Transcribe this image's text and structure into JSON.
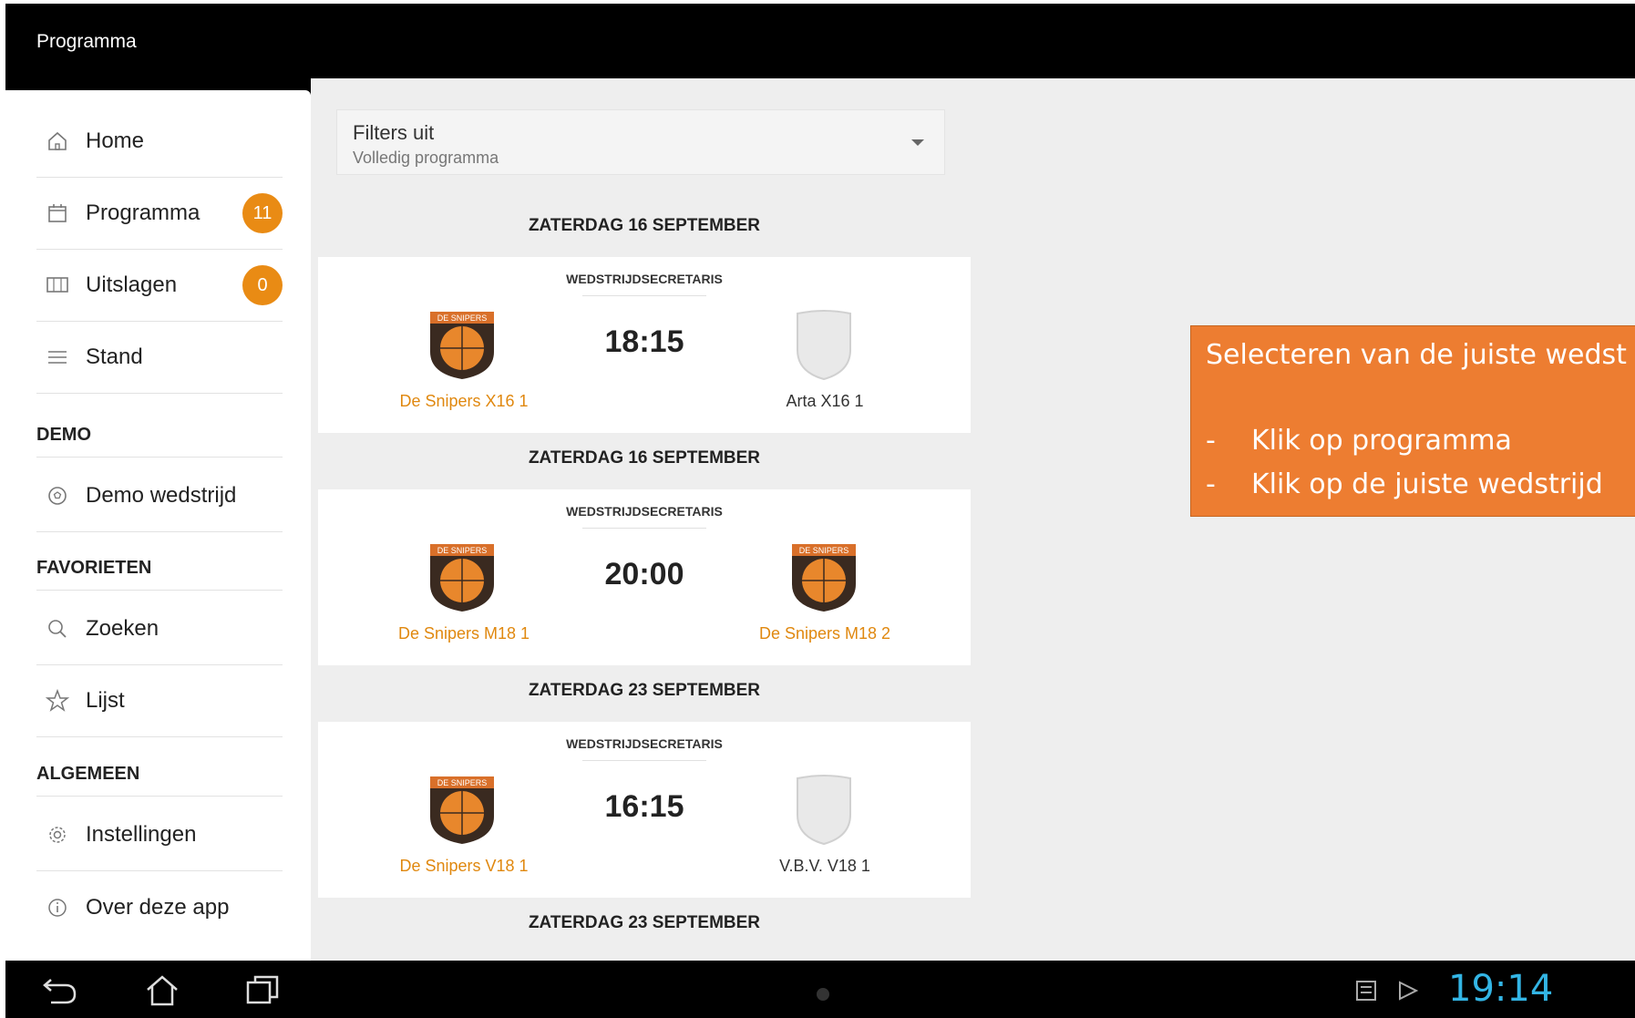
{
  "appbar": {
    "title": "Programma"
  },
  "drawer": {
    "items": [
      {
        "label": "Home",
        "icon": "home-icon"
      },
      {
        "label": "Programma",
        "icon": "calendar-icon",
        "badge": "11"
      },
      {
        "label": "Uitslagen",
        "icon": "scoreboard-icon",
        "badge": "0"
      },
      {
        "label": "Stand",
        "icon": "list-icon"
      }
    ],
    "sections": {
      "demo": "DEMO",
      "favorieten": "FAVORIETEN",
      "algemeen": "ALGEMEEN"
    },
    "demo_items": [
      {
        "label": "Demo wedstrijd",
        "icon": "ball-icon"
      }
    ],
    "fav_items": [
      {
        "label": "Zoeken",
        "icon": "search-icon"
      },
      {
        "label": "Lijst",
        "icon": "star-icon"
      }
    ],
    "general_items": [
      {
        "label": "Instellingen",
        "icon": "gear-icon"
      },
      {
        "label": "Over deze app",
        "icon": "info-icon"
      }
    ]
  },
  "filter": {
    "title": "Filters uit",
    "subtitle": "Volledig programma"
  },
  "matches": [
    {
      "date": "ZATERDAG 16 SEPTEMBER",
      "role": "WEDSTRIJDSECRETARIS",
      "time": "18:15",
      "home": "De Snipers X16 1",
      "away": "Arta X16 1",
      "home_logo": "snipers",
      "away_logo": "blank"
    },
    {
      "date": "ZATERDAG 16 SEPTEMBER",
      "role": "WEDSTRIJDSECRETARIS",
      "time": "20:00",
      "home": "De Snipers M18 1",
      "away": "De Snipers M18 2",
      "home_logo": "snipers",
      "away_logo": "snipers"
    },
    {
      "date": "ZATERDAG 23 SEPTEMBER",
      "role": "WEDSTRIJDSECRETARIS",
      "time": "16:15",
      "home": "De Snipers V18 1",
      "away": "V.B.V. V18 1",
      "home_logo": "snipers",
      "away_logo": "blank"
    }
  ],
  "next_date": "ZATERDAG 23 SEPTEMBER",
  "callout": {
    "heading": "Selecteren van de juiste wedst",
    "bullets": [
      "Klik op programma",
      "Klik op de juiste wedstrijd"
    ],
    "bullet_marker": "-"
  },
  "sysbar": {
    "clock": "19:14"
  },
  "colors": {
    "accent": "#e98b14",
    "callout": "#ed7d31",
    "clock": "#33b5e5"
  }
}
